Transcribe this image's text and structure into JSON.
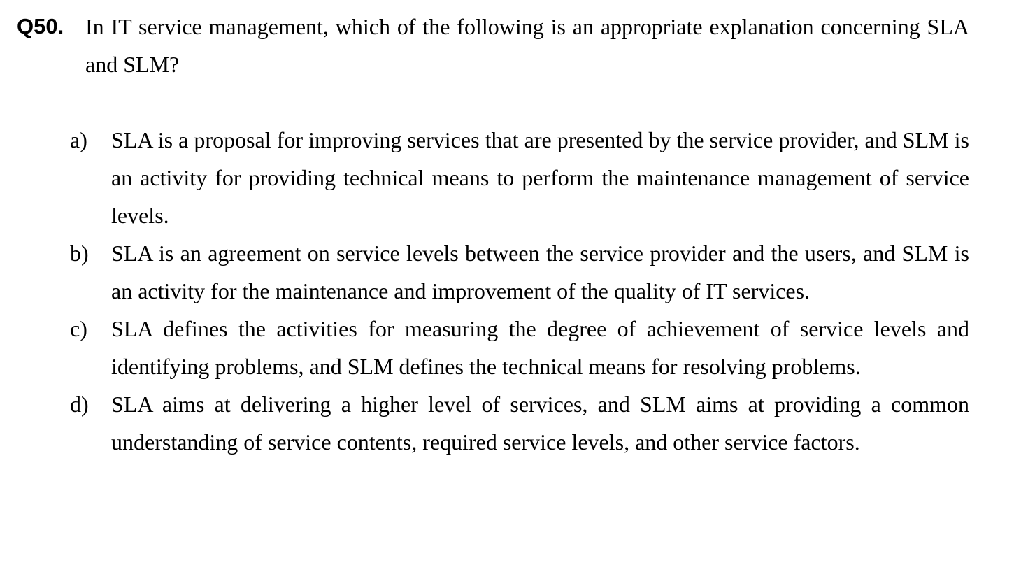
{
  "question": {
    "number": "Q50.",
    "text": "In IT service management, which of the following is an appropriate explanation concerning SLA and SLM?"
  },
  "options": [
    {
      "letter": "a)",
      "text": "SLA is a proposal for improving services that are presented by the service provider, and SLM is an activity for providing technical means to perform the maintenance management of service levels."
    },
    {
      "letter": "b)",
      "text": "SLA is an agreement on service levels between the service provider and the users, and SLM is an activity for the maintenance and improvement of the quality of IT services."
    },
    {
      "letter": "c)",
      "text": "SLA defines the activities for measuring the degree of achievement of service levels and identifying problems, and SLM defines the technical means for resolving problems."
    },
    {
      "letter": "d)",
      "text": "SLA aims at delivering a higher level of services, and SLM aims at providing a common understanding of service contents, required service levels, and other service factors."
    }
  ]
}
